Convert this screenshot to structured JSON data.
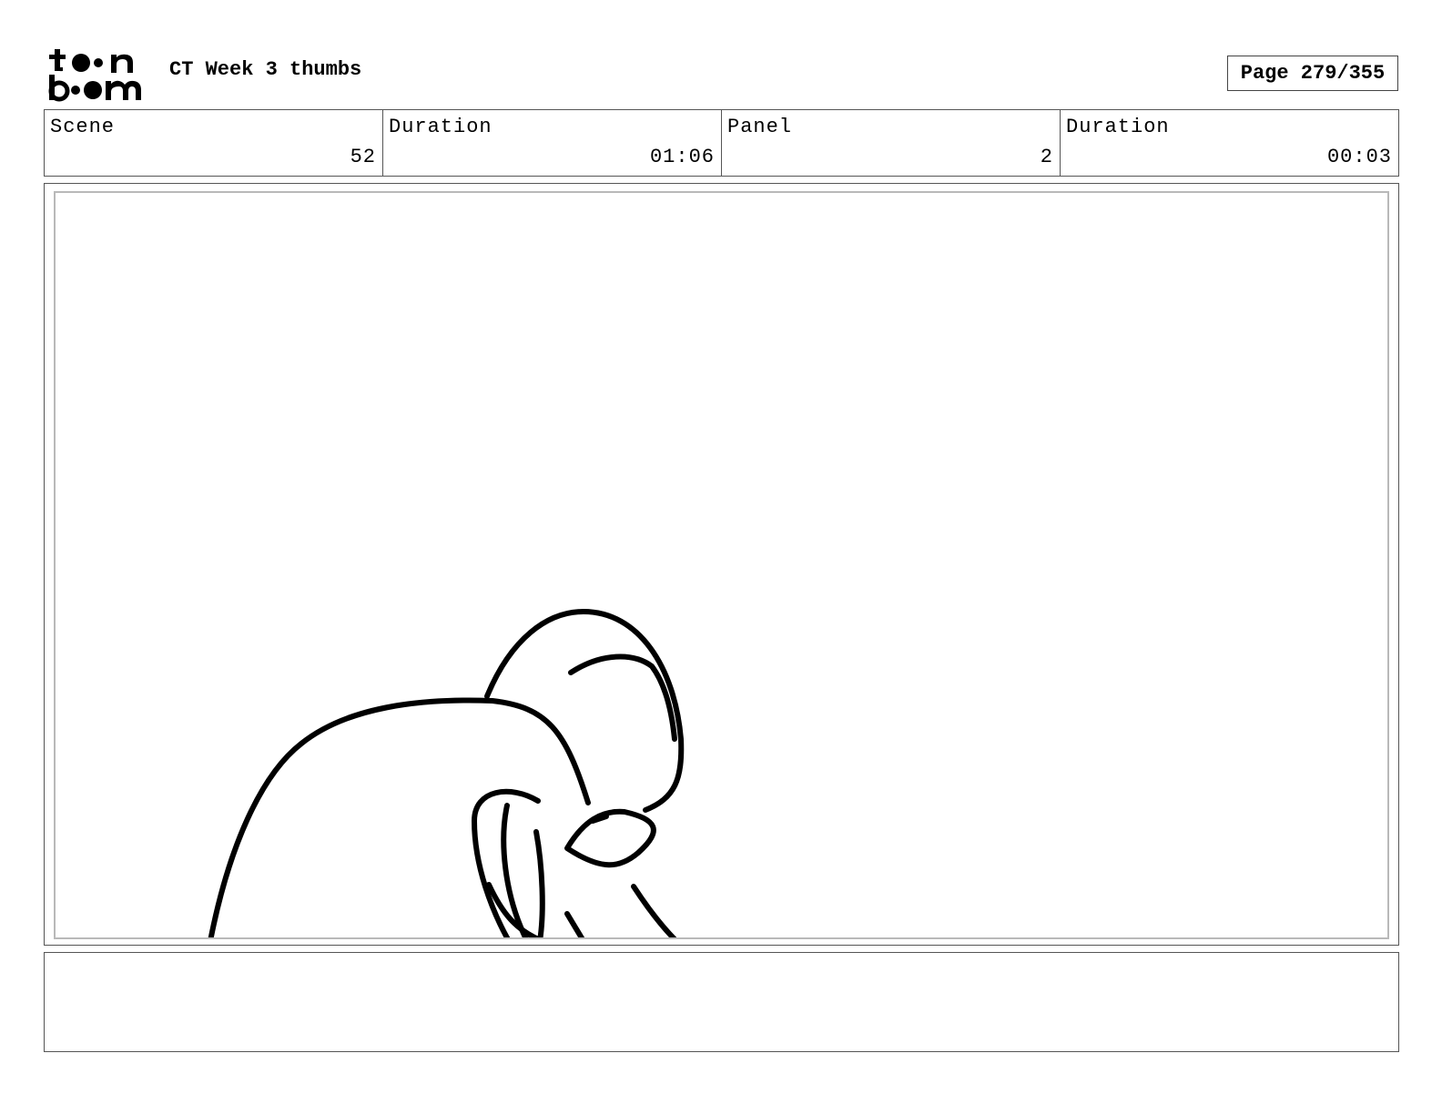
{
  "header": {
    "document_title": "CT Week 3 thumbs",
    "page_label": "Page 279/355"
  },
  "info": {
    "scene_label": "Scene",
    "scene_value": "52",
    "scene_duration_label": "Duration",
    "scene_duration_value": "01:06",
    "panel_label": "Panel",
    "panel_value": "2",
    "panel_duration_label": "Duration",
    "panel_duration_value": "00:03"
  },
  "notes": {
    "text": ""
  }
}
